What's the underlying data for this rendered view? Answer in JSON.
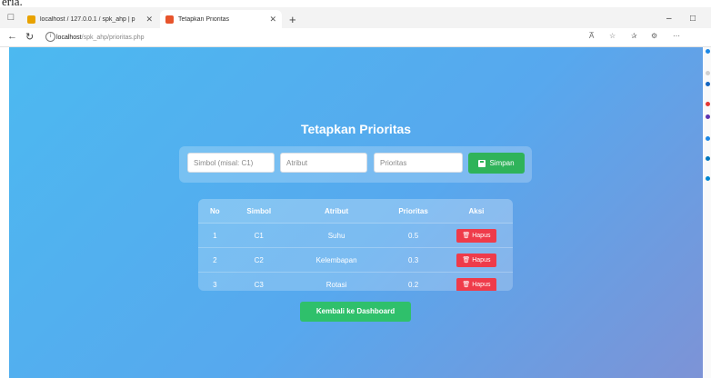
{
  "top_fragment": "eria.",
  "browser": {
    "tabs": [
      {
        "label": "localhost / 127.0.0.1 / spk_ahp | p",
        "active": false,
        "favicon_color": "#e8a200"
      },
      {
        "label": "Tetapkan Prioritas",
        "active": true,
        "favicon_color": "#e7542c"
      }
    ],
    "new_tab_symbol": "+",
    "address": {
      "host": "localhost",
      "path": "/spk_ahp/prioritas.php"
    },
    "zoom_badge": "A̅",
    "window_controls": {
      "minimize": "–",
      "maximize": "□"
    }
  },
  "page": {
    "title": "Tetapkan Prioritas",
    "form": {
      "simbol_placeholder": "Simbol (misal: C1)",
      "atribut_placeholder": "Atribut",
      "prioritas_placeholder": "Prioritas",
      "save_label": "Simpan"
    },
    "table": {
      "headers": [
        "No",
        "Simbol",
        "Atribut",
        "Prioritas",
        "Aksi"
      ],
      "rows": [
        {
          "no": "1",
          "simbol": "C1",
          "atribut": "Suhu",
          "prioritas": "0.5",
          "aksi": "🗑 Hapus"
        },
        {
          "no": "2",
          "simbol": "C2",
          "atribut": "Kelembapan",
          "prioritas": "0.3",
          "aksi": "🗑 Hapus"
        },
        {
          "no": "3",
          "simbol": "C3",
          "atribut": "Rotasi",
          "prioritas": "0.2",
          "aksi": "🗑 Hapus"
        }
      ]
    },
    "back_label": "Kembali ke Dashboard"
  },
  "colors": {
    "save_button": "#2fb35a",
    "delete_button": "#ef3b4a",
    "back_button": "#2fc06b"
  }
}
